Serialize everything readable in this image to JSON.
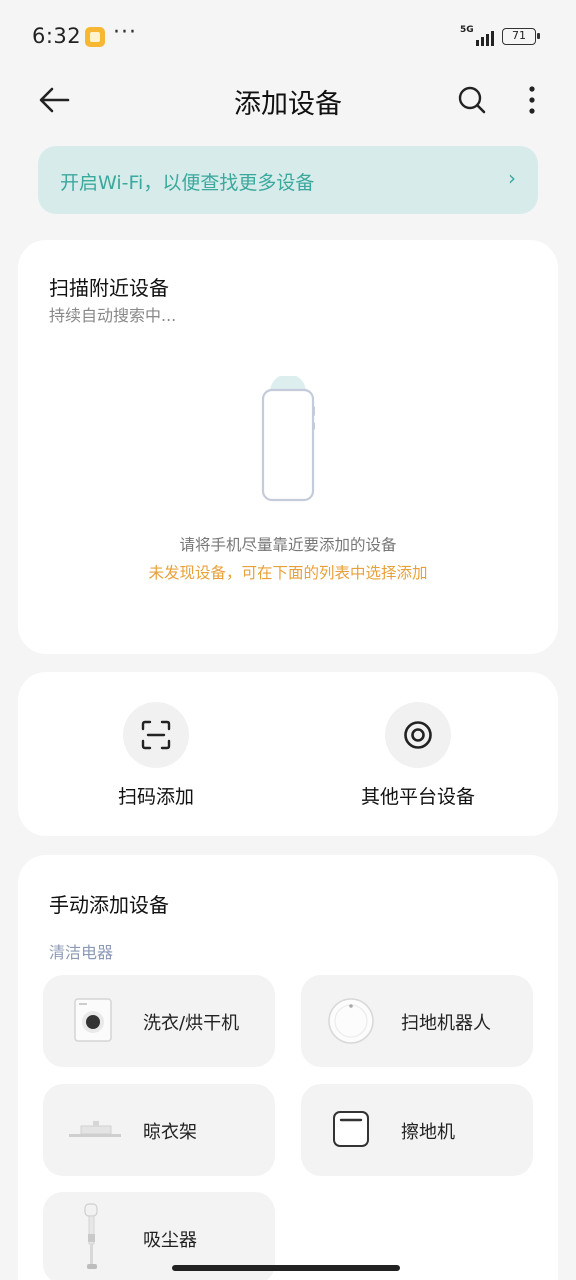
{
  "status_bar": {
    "time": "6:32",
    "more": "···",
    "network": "5G",
    "battery": "71"
  },
  "app_bar": {
    "title": "添加设备"
  },
  "wifi_banner": {
    "text": "开启Wi-Fi，以便查找更多设备",
    "chevron": "›"
  },
  "scan": {
    "title": "扫描附近设备",
    "subtitle": "持续自动搜索中...",
    "hint": "请将手机尽量靠近要添加的设备",
    "warning": "未发现设备，可在下面的列表中选择添加"
  },
  "quick_actions": [
    {
      "label": "扫码添加",
      "icon": "scan-code-icon"
    },
    {
      "label": "其他平台设备",
      "icon": "other-platform-icon"
    }
  ],
  "manual": {
    "title": "手动添加设备",
    "category": "清洁电器",
    "devices": [
      {
        "label": "洗衣/烘干机",
        "icon": "washing-machine-icon"
      },
      {
        "label": "扫地机器人",
        "icon": "robot-vacuum-icon"
      },
      {
        "label": "晾衣架",
        "icon": "clothes-rack-icon"
      },
      {
        "label": "擦地机",
        "icon": "floor-scrubber-icon"
      },
      {
        "label": "吸尘器",
        "icon": "vacuum-cleaner-icon"
      }
    ]
  },
  "colors": {
    "accent_teal": "#3aa89d",
    "banner_bg": "#d7ecea",
    "warning": "#e8a13a",
    "category": "#8c9ab5"
  }
}
